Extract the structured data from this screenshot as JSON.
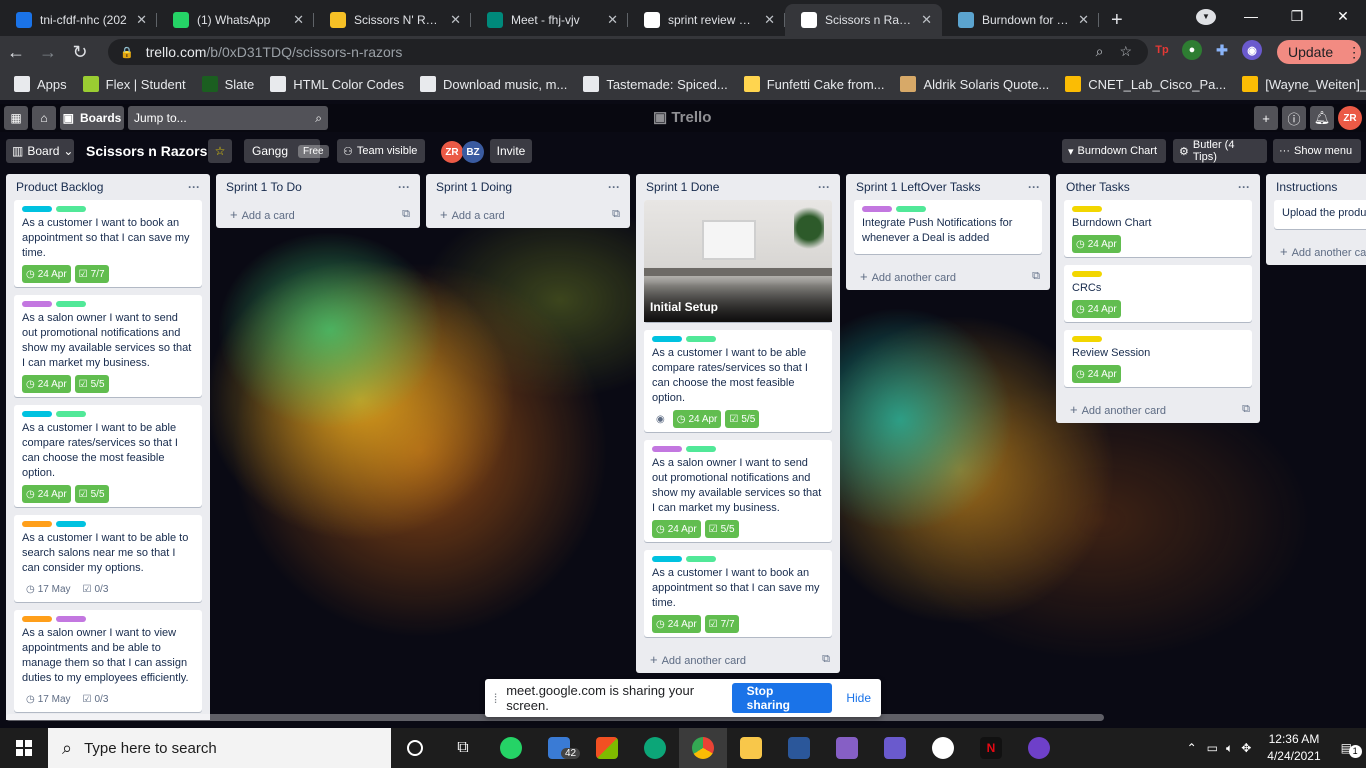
{
  "browser": {
    "tabs": [
      {
        "title": "tni-cfdf-nhc (202",
        "favicon": "#1a73e8",
        "active": false
      },
      {
        "title": "(1) WhatsApp",
        "favicon": "#25d366",
        "active": false
      },
      {
        "title": "Scissors N' Razors",
        "favicon": "#f6c026",
        "active": false
      },
      {
        "title": "Meet - fhj-vjv",
        "favicon": "#00897b",
        "active": false
      },
      {
        "title": "sprint review and",
        "favicon": "#ffffff",
        "active": false
      },
      {
        "title": "Scissors n Razors",
        "favicon": "#ffffff",
        "active": true
      },
      {
        "title": "Burndown for Tre",
        "favicon": "#5ba4cf",
        "active": false
      }
    ],
    "new_tab": "+",
    "url_host": "trello.com",
    "url_path": "/b/0xD31TDQ/scissors-n-razors",
    "update_label": "Update",
    "bookmarks": [
      {
        "label": "Apps",
        "color": "#e8eaed"
      },
      {
        "label": "Flex | Student",
        "color": "#9acd32"
      },
      {
        "label": "Slate",
        "color": "#1b5e20"
      },
      {
        "label": "HTML Color Codes",
        "color": "#e8eaed"
      },
      {
        "label": "Download music, m...",
        "color": "#e8eaed"
      },
      {
        "label": "Tastemade: Spiced...",
        "color": "#e8eaed"
      },
      {
        "label": "Funfetti Cake from...",
        "color": "#ffd54f"
      },
      {
        "label": "Aldrik Solaris Quote...",
        "color": "#d7a968"
      },
      {
        "label": "CNET_Lab_Cisco_Pa...",
        "color": "#fbbc04"
      },
      {
        "label": "[Wayne_Weiten]_Ps...",
        "color": "#fbbc04"
      }
    ]
  },
  "trello": {
    "boards_label": "Boards",
    "jump_placeholder": "Jump to...",
    "logo": "Trello",
    "board_view": "Board",
    "board_name": "Scissors n Razors",
    "team": "Gangg",
    "team_badge": "Free",
    "visibility": "Team visible",
    "members": [
      "ZR",
      "BZ"
    ],
    "invite_label": "Invite",
    "burndown_label": "Burndown Chart",
    "butler_label": "Butler (4 Tips)",
    "menu_label": "Show menu",
    "user_initials": "ZR"
  },
  "lists": [
    {
      "title": "Product Backlog",
      "add_label": "Add another card",
      "cards": [
        {
          "labels": [
            "#00c2e0",
            "#51e898"
          ],
          "text": "As a customer I want to book an appointment so that I can save my time.",
          "date": "24 Apr",
          "checklist": "7/7",
          "done": true
        },
        {
          "labels": [
            "#c377e0",
            "#51e898"
          ],
          "text": "As a salon owner I want to send out promotional notifications and show my available services so that I can market my business.",
          "date": "24 Apr",
          "checklist": "5/5",
          "done": true
        },
        {
          "labels": [
            "#00c2e0",
            "#51e898"
          ],
          "text": "As a customer I want to be able compare rates/services so that I can choose the most feasible option.",
          "date": "24 Apr",
          "checklist": "5/5",
          "done": true
        },
        {
          "labels": [
            "#ff9f1a",
            "#00c2e0"
          ],
          "text": "As a customer I want to be able to search salons near me so that I can consider my options.",
          "date": "17 May",
          "checklist": "0/3",
          "done": false
        },
        {
          "labels": [
            "#ff9f1a",
            "#c377e0"
          ],
          "text": "As a salon owner I want to view appointments and be able to manage them so that I can assign duties to my employees efficiently.",
          "date": "17 May",
          "checklist": "0/3",
          "done": false
        }
      ]
    },
    {
      "title": "Sprint 1 To Do",
      "add_label": "Add a card",
      "cards": []
    },
    {
      "title": "Sprint 1 Doing",
      "add_label": "Add a card",
      "cards": []
    },
    {
      "title": "Sprint 1 Done",
      "add_label": "Add another card",
      "cover_title": "Initial Setup",
      "cards": [
        {
          "labels": [
            "#00c2e0",
            "#51e898"
          ],
          "text": "As a customer I want to be able compare rates/services so that I can choose the most feasible option.",
          "date": "24 Apr",
          "checklist": "5/5",
          "done": true,
          "watch": true
        },
        {
          "labels": [
            "#c377e0",
            "#51e898"
          ],
          "text": "As a salon owner I want to send out promotional notifications and show my available services so that I can market my business.",
          "date": "24 Apr",
          "checklist": "5/5",
          "done": true
        },
        {
          "labels": [
            "#00c2e0",
            "#51e898"
          ],
          "text": "As a customer I want to book an appointment so that I can save my time.",
          "date": "24 Apr",
          "checklist": "7/7",
          "done": true
        }
      ]
    },
    {
      "title": "Sprint 1 LeftOver Tasks",
      "add_label": "Add another card",
      "cards": [
        {
          "labels": [
            "#c377e0",
            "#51e898"
          ],
          "text": "Integrate Push Notifications for whenever a Deal is added"
        }
      ]
    },
    {
      "title": "Other Tasks",
      "add_label": "Add another card",
      "cards": [
        {
          "labels": [
            "#f2d600"
          ],
          "text": "Burndown Chart",
          "date": "24 Apr",
          "done": true
        },
        {
          "labels": [
            "#f2d600"
          ],
          "text": "CRCs",
          "date": "24 Apr",
          "done": true
        },
        {
          "labels": [
            "#f2d600"
          ],
          "text": "Review Session",
          "date": "24 Apr",
          "done": true
        }
      ]
    },
    {
      "title": "Instructions",
      "add_label": "Add another ca",
      "cards": [
        {
          "labels": [],
          "text": "Upload the produc"
        }
      ]
    }
  ],
  "share_bar": {
    "message": "meet.google.com is sharing your screen.",
    "stop_label": "Stop sharing",
    "hide_label": "Hide"
  },
  "taskbar": {
    "search_placeholder": "Type here to search",
    "mail_badge": "42",
    "time": "12:36 AM",
    "date": "4/24/2021",
    "notification_count": "1"
  }
}
